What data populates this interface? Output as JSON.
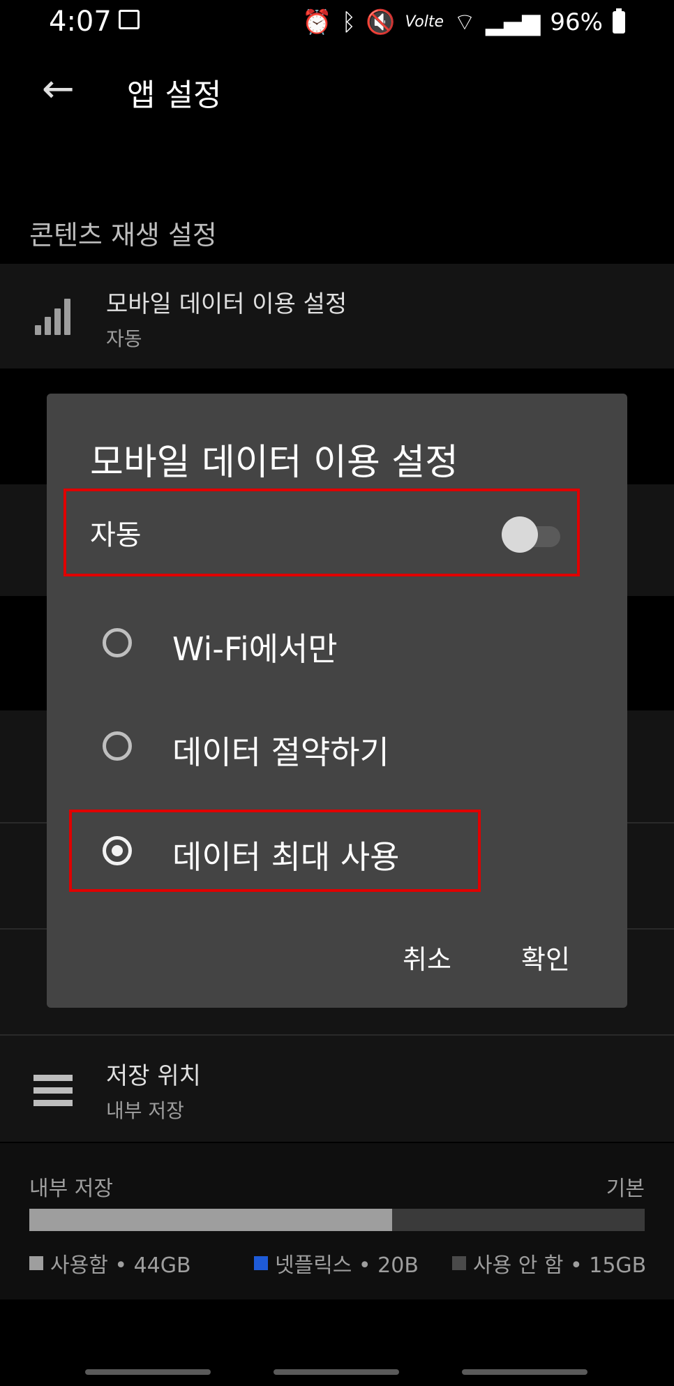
{
  "status_bar": {
    "time": "4:07",
    "battery": "96%",
    "icons": [
      "image-icon",
      "alarm-icon",
      "bluetooth-icon",
      "mute-icon",
      "volte-icon",
      "wifi-icon",
      "signal-icon",
      "battery-icon"
    ]
  },
  "app_bar": {
    "title": "앱 설정"
  },
  "section_playback": {
    "title": "콘텐츠 재생 설정"
  },
  "mobile_data_row": {
    "title": "모바일 데이터 이용 설정",
    "value": "자동"
  },
  "storage_location_row": {
    "title": "저장 위치",
    "value": "내부 저장"
  },
  "storage": {
    "label": "내부 저장",
    "right_label": "기본",
    "used_fraction": 0.59,
    "legend": [
      {
        "label": "사용함 • 44GB",
        "color": "#9e9e9e"
      },
      {
        "label": "넷플릭스 • 20B",
        "color": "#1e5bd8"
      },
      {
        "label": "사용 안 함 • 15GB",
        "color": "#4a4a4a"
      }
    ]
  },
  "dialog": {
    "title": "모바일 데이터 이용 설정",
    "auto_label": "자동",
    "auto_enabled": false,
    "options": [
      {
        "label": "Wi-Fi에서만",
        "selected": false
      },
      {
        "label": "데이터 절약하기",
        "selected": false
      },
      {
        "label": "데이터 최대 사용",
        "selected": true
      }
    ],
    "cancel": "취소",
    "confirm": "확인"
  },
  "colors": {
    "highlight_box": "#e00000",
    "dialog_bg": "#444444"
  }
}
